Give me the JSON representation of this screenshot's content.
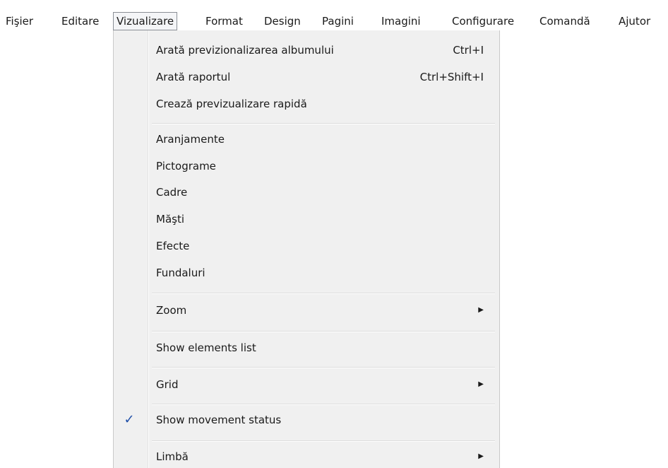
{
  "menubar": {
    "items": [
      {
        "label": "Fişier"
      },
      {
        "label": "Editare"
      },
      {
        "label": "Vizualizare"
      },
      {
        "label": "Format"
      },
      {
        "label": "Design"
      },
      {
        "label": "Pagini"
      },
      {
        "label": "Imagini"
      },
      {
        "label": "Configurare"
      },
      {
        "label": "Comandă"
      },
      {
        "label": "Ajutor"
      }
    ]
  },
  "dropdown": {
    "items": [
      {
        "label": "Arată previzionalizarea albumului",
        "shortcut": "Ctrl+I"
      },
      {
        "label": "Arată raportul",
        "shortcut": "Ctrl+Shift+I"
      },
      {
        "label": "Crează previzualizare rapidă"
      },
      {
        "label": "Aranjamente"
      },
      {
        "label": "Pictograme"
      },
      {
        "label": "Cadre"
      },
      {
        "label": "Măşti"
      },
      {
        "label": "Efecte"
      },
      {
        "label": "Fundaluri"
      },
      {
        "label": "Zoom",
        "submenu": true
      },
      {
        "label": "Show elements list"
      },
      {
        "label": "Grid",
        "submenu": true
      },
      {
        "label": "Show movement status",
        "checked": true
      },
      {
        "label": "Limbă",
        "submenu": true
      }
    ],
    "check_glyph": "✓",
    "submenu_glyph": "▶"
  },
  "colors": {
    "menu_background": "#f0f0f0",
    "check_color": "#1f4fa8"
  }
}
